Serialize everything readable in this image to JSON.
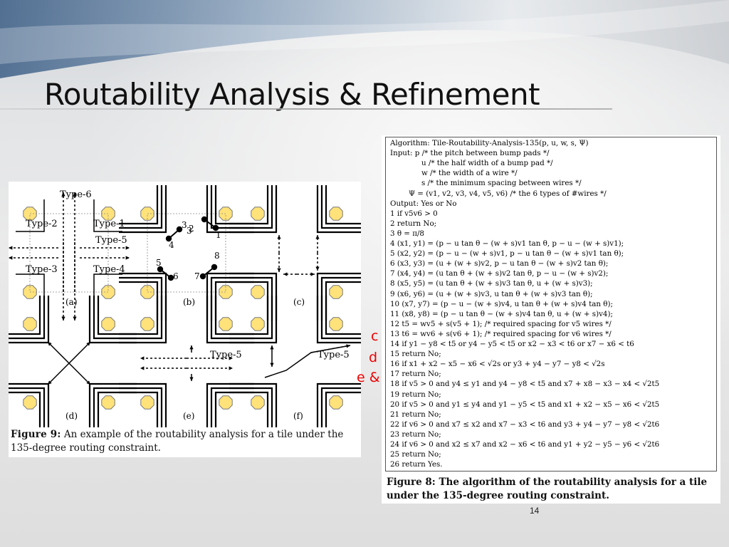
{
  "slide": {
    "title": "Routability Analysis & Refinement",
    "page_number": "14"
  },
  "figure9": {
    "labels": {
      "type6": "Type-6",
      "type1": "Type-1",
      "type2": "Type-2",
      "type5": "Type-5",
      "type3": "Type-3",
      "type4": "Type-4",
      "type5_e": "Type-5",
      "type5_f": "Type-5"
    },
    "panels": [
      "(a)",
      "(b)",
      "(c)",
      "(d)",
      "(e)",
      "(f)"
    ],
    "numbers": [
      "1",
      "2",
      "3",
      "4",
      "5",
      "6",
      "7",
      "8"
    ],
    "caption_label": "Figure 9:",
    "caption_text": "An example of the routability analysis for a tile under the 135-degree routing constraint."
  },
  "annotations": [
    "c",
    "d",
    "e & f"
  ],
  "algorithm": {
    "lines": [
      "Algorithm: Tile-Routability-Analysis-135(p, u, w, s, Ψ)",
      "Input: p /* the pitch between bump pads */",
      "u /* the half width of a bump pad */",
      "w /* the width of a wire */",
      "s /* the minimum spacing between wires */",
      "Ψ = (v1, v2, v3, v4, v5, v6) /* the 6 types of #wires */",
      "Output: Yes or No",
      "1 if v5v6 > 0",
      "2 return No;",
      "3 θ = π/8",
      "4 (x1, y1) = (p − u tan θ − (w + s)v1 tan θ, p − u − (w + s)v1);",
      "5 (x2, y2) = (p − u − (w + s)v1, p − u tan θ − (w + s)v1 tan θ);",
      "6 (x3, y3) = (u + (w + s)v2, p − u tan θ − (w + s)v2 tan θ);",
      "7 (x4, y4) = (u tan θ + (w + s)v2 tan θ, p − u − (w + s)v2);",
      "8 (x5, y5) = (u tan θ + (w + s)v3 tan θ, u + (w + s)v3);",
      "9 (x6, y6) = (u + (w + s)v3, u tan θ + (w + s)v3 tan θ);",
      "10 (x7, y7) = (p − u − (w + s)v4, u tan θ + (w + s)v4 tan θ);",
      "11 (x8, y8) = (p − u tan θ − (w + s)v4 tan θ, u + (w + s)v4);",
      "12 t5 = wv5 + s(v5 + 1); /* required spacing for v5 wires */",
      "13 t6 = wv6 + s(v6 + 1); /* required spacing for v6 wires */",
      "14 if y1 − y8 < t5 or y4 − y5 < t5 or x2 − x3 < t6 or x7 − x6 < t6",
      "15 return No;",
      "16 if x1 + x2 − x5 − x6 < √2s or y3 + y4 − y7 − y8 < √2s",
      "17 return No;",
      "18 if v5 > 0 and y4 ≤ y1 and y4 − y8 < t5 and x7 + x8 − x3 − x4 < √2t5",
      "19 return No;",
      "20 if v5 > 0 and y1 ≤ y4 and y1 − y5 < t5 and x1 + x2 − x5 − x6 < √2t5",
      "21 return No;",
      "22 if v6 > 0 and x7 ≤ x2 and x7 − x3 < t6 and y3 + y4 − y7 − y8 < √2t6",
      "23 return No;",
      "24 if v6 > 0 and x2 ≤ x7 and x2 − x6 < t6 and y1 + y2 − y5 − y6 < √2t6",
      "25 return No;",
      "26 return Yes."
    ],
    "caption_label": "Figure 8:",
    "caption_text": "The algorithm of the routability analysis for a tile under the 135-degree routing constraint."
  },
  "colors": {
    "pad_fill": "#ffe27a",
    "pad_stroke": "#777777",
    "annotation": "#ee0000"
  }
}
